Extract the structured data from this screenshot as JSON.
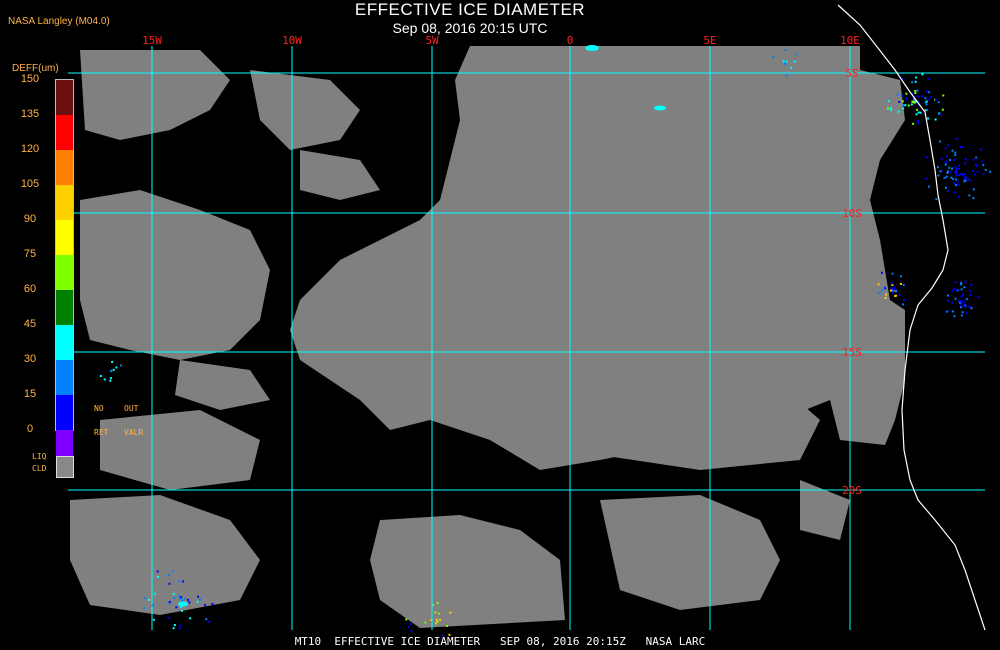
{
  "header": {
    "title": "EFFECTIVE ICE DIAMETER",
    "subtitle": "Sep 08, 2016 20:15 UTC",
    "producer": "NASA Langley (M04.0)"
  },
  "legend": {
    "title": "DEFF(um)",
    "ticks": [
      "150",
      "135",
      "120",
      "105",
      "90",
      "75",
      "60",
      "45",
      "30",
      "15",
      "0"
    ],
    "colors": [
      "#6b0f0f",
      "#ff0000",
      "#ff8000",
      "#ffd000",
      "#ffff00",
      "#80ff00",
      "#008000",
      "#00ffff",
      "#0080ff",
      "#0000ff",
      "#8000ff"
    ],
    "no_label": "NO",
    "ret_label": "RET",
    "out_label": "OUT",
    "valr_label": "VALR",
    "liq_label1": "LIQ",
    "liq_label2": "CLD",
    "liq_color": "#888888"
  },
  "map": {
    "lon_labels": [
      "15W",
      "10W",
      "5W",
      "0",
      "5E",
      "10E"
    ],
    "lat_labels": [
      "5S",
      "10S",
      "15S",
      "20S"
    ],
    "grid_color": "#00ffff",
    "label_color": "#ff2020",
    "cloud_color": "#808080",
    "coast_color": "#ffffff"
  },
  "footer": {
    "text": "MT10  EFFECTIVE ICE DIAMETER   SEP 08, 2016 20:15Z   NASA LARC"
  }
}
